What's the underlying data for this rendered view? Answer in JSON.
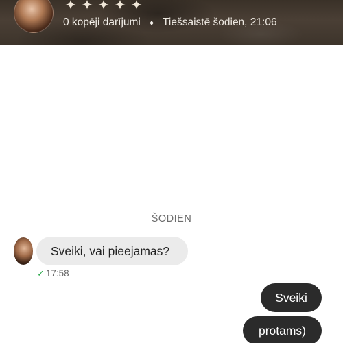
{
  "header": {
    "rating_stars": [
      "✦",
      "✦",
      "✦",
      "✦",
      "✦"
    ],
    "trades_link": "0 kopēji darījumi",
    "separator": "♦",
    "online_status": "Tiešsaistē šodien, 21:06"
  },
  "chat": {
    "day_separator": "ŠODIEN",
    "incoming": {
      "text": "Sveiki, vai pieejamas?",
      "time": "17:58",
      "status_icon": "✓"
    },
    "outgoing": [
      {
        "text": "Sveiki"
      },
      {
        "text": "protams)"
      }
    ]
  }
}
